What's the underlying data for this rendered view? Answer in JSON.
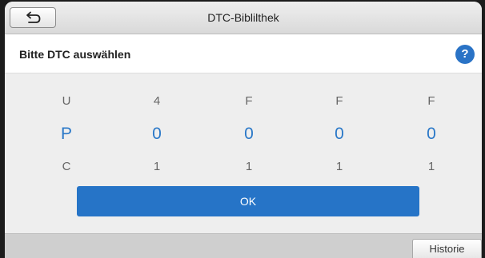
{
  "titlebar": {
    "title": "DTC-Biblilthek",
    "back_icon": "back-arrow-icon"
  },
  "header": {
    "label": "Bitte DTC auswählen",
    "help_glyph": "?",
    "accent": "#2a73c6"
  },
  "picker": {
    "columns": [
      {
        "upper": "U",
        "selected": "P",
        "lower": "C"
      },
      {
        "upper": "4",
        "selected": "0",
        "lower": "1"
      },
      {
        "upper": "F",
        "selected": "0",
        "lower": "1"
      },
      {
        "upper": "F",
        "selected": "0",
        "lower": "1"
      },
      {
        "upper": "F",
        "selected": "0",
        "lower": "1"
      }
    ],
    "selected_color": "#2a78c8"
  },
  "ok_button": {
    "label": "OK"
  },
  "footer": {
    "history_label": "Historie"
  }
}
